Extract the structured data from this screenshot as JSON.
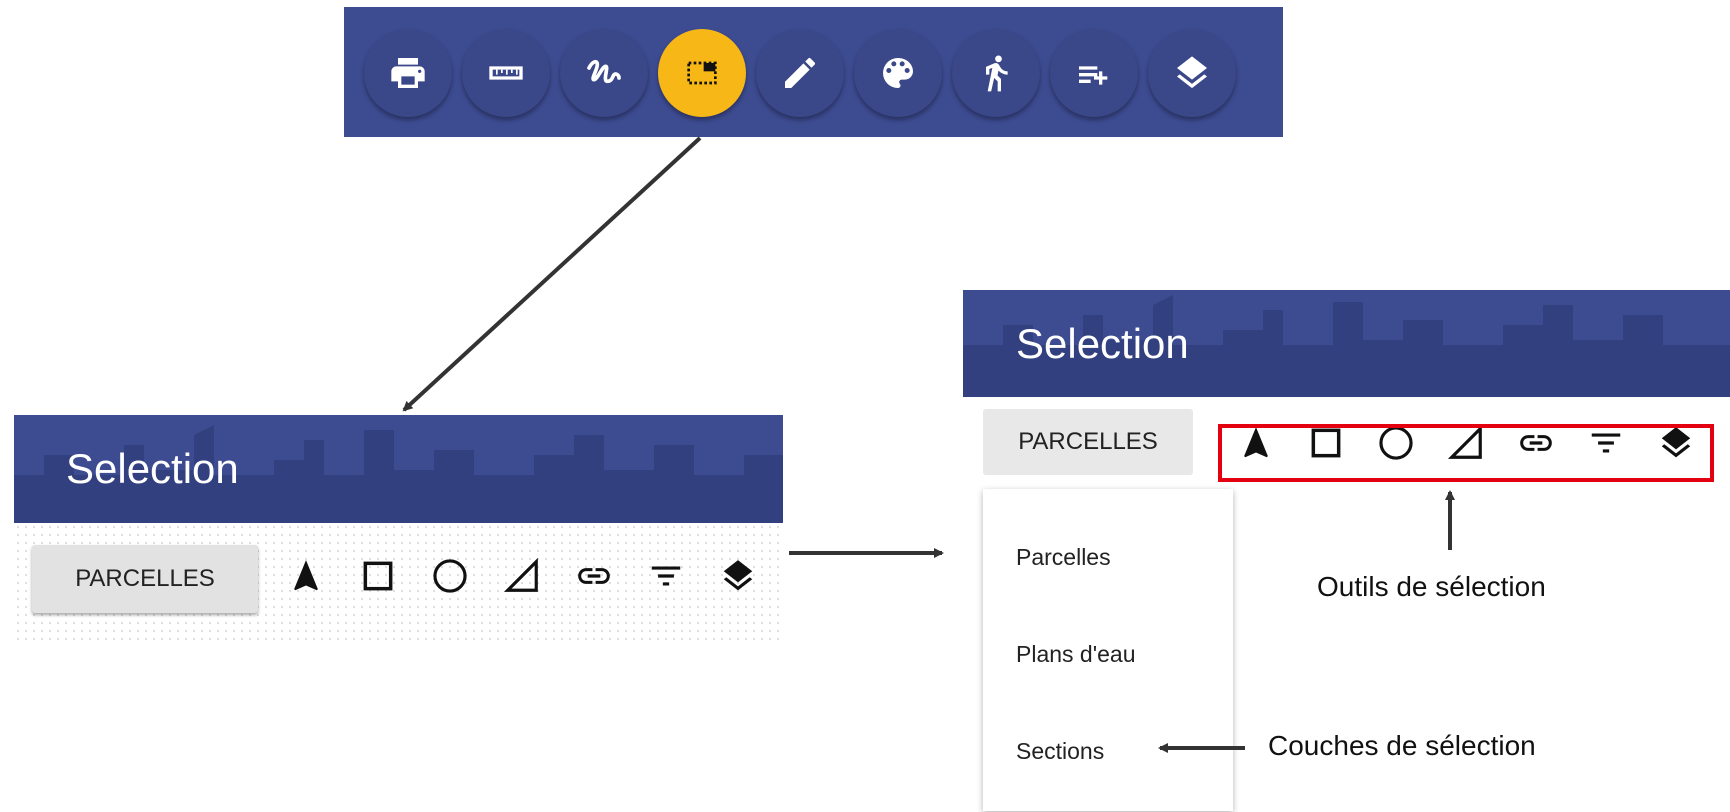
{
  "toolbar": {
    "buttons": [
      {
        "icon": "printer-icon",
        "active": false
      },
      {
        "icon": "ruler-icon",
        "active": false
      },
      {
        "icon": "freehand-draw-icon",
        "active": false
      },
      {
        "icon": "selection-icon",
        "active": true
      },
      {
        "icon": "pencil-icon",
        "active": false
      },
      {
        "icon": "palette-icon",
        "active": false
      },
      {
        "icon": "walking-person-icon",
        "active": false
      },
      {
        "icon": "playlist-add-icon",
        "active": false
      },
      {
        "icon": "layers-icon",
        "active": false
      }
    ],
    "colors": {
      "background": "#3d4b91",
      "active": "#f7b717"
    }
  },
  "panel_left": {
    "title": "Selection",
    "layer_button": "PARCELLES",
    "icons": [
      "navigation-arrow-icon",
      "square-icon",
      "circle-icon",
      "triangle-icon",
      "link-icon",
      "filter-icon",
      "layers-icon"
    ]
  },
  "panel_right": {
    "title": "Selection",
    "layer_button": "PARCELLES",
    "icons": [
      "navigation-arrow-icon",
      "square-icon",
      "circle-icon",
      "triangle-icon",
      "link-icon",
      "filter-icon",
      "layers-icon"
    ],
    "dropdown": [
      "Parcelles",
      "Plans d'eau",
      "Sections"
    ]
  },
  "annotations": {
    "tools": "Outils de sélection",
    "layers": "Couches de sélection"
  }
}
